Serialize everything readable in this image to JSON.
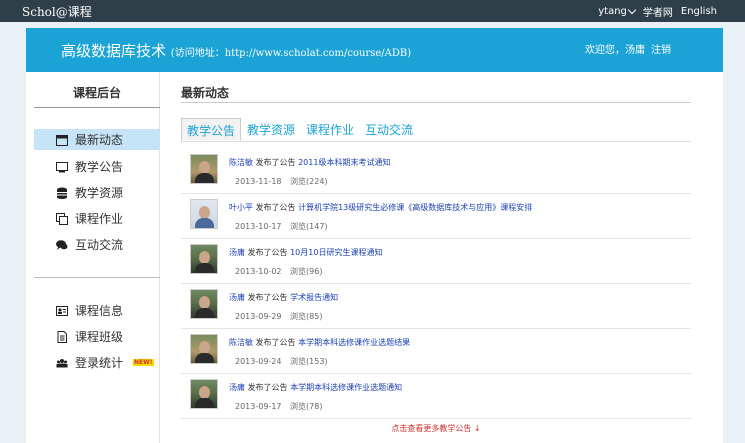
{
  "topbar": {
    "brand": "Schol@课程",
    "user": "ytang",
    "links": [
      "学者网",
      "English"
    ]
  },
  "banner": {
    "title": "高级数据库技术",
    "url_text": "(访问地址：http://www.scholat.com/course/ADB)",
    "welcome": "欢迎您，汤庸",
    "logout": "注销"
  },
  "sidebar": {
    "heading": "课程后台",
    "items": [
      {
        "label": "最新动态",
        "icon": "calendar-icon"
      },
      {
        "label": "教学公告",
        "icon": "monitor-icon"
      },
      {
        "label": "教学资源",
        "icon": "database-icon"
      },
      {
        "label": "课程作业",
        "icon": "copy-icon"
      },
      {
        "label": "互动交流",
        "icon": "chat-icon"
      }
    ],
    "items2": [
      {
        "label": "课程信息",
        "icon": "id-card-icon"
      },
      {
        "label": "课程班级",
        "icon": "document-icon"
      },
      {
        "label": "登录统计",
        "icon": "users-icon",
        "badge": "NEW!"
      }
    ]
  },
  "content": {
    "section_title": "最新动态",
    "tabs": [
      "教学公告",
      "教学资源",
      "课程作业",
      "互动交流"
    ],
    "feed": [
      {
        "name": "陈洁敏",
        "action": "发布了公告",
        "title": "2011级本科期末考试通知",
        "date": "2013-11-18",
        "views": "浏览(224)"
      },
      {
        "name": "叶小平",
        "action": "发布了公告",
        "title": "计算机学院13级研究生必修课《高级数据库技术与应用》课程安排",
        "date": "2013-10-17",
        "views": "浏览(147)"
      },
      {
        "name": "汤庸",
        "action": "发布了公告",
        "title": "10月10日研究生课程通知",
        "date": "2013-10-02",
        "views": "浏览(96)"
      },
      {
        "name": "汤庸",
        "action": "发布了公告",
        "title": "学术报告通知",
        "date": "2013-09-29",
        "views": "浏览(85)"
      },
      {
        "name": "陈洁敏",
        "action": "发布了公告",
        "title": "本学期本科选修课作业选题结果",
        "date": "2013-09-24",
        "views": "浏览(153)"
      },
      {
        "name": "汤庸",
        "action": "发布了公告",
        "title": "本学期本科选修课作业选题通知",
        "date": "2013-09-17",
        "views": "浏览(78)"
      }
    ],
    "more": "点击查看更多教学公告 ↓"
  }
}
